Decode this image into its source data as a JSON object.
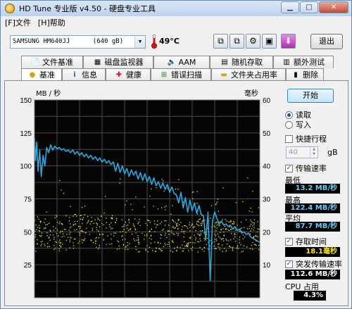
{
  "window": {
    "title": "HD Tune 专业版 v4.50 - 硬盘专业工具"
  },
  "menu": [
    {
      "label": "[F]文件"
    },
    {
      "label": "[H]帮助"
    }
  ],
  "toolbar": {
    "drive_name": "SAMSUNG HM640JJ",
    "drive_size": "(640 gB)",
    "temperature": "49°C",
    "exit_label": "退出"
  },
  "tabs_top": [
    {
      "label": "文件基准",
      "icon": "file-benchmark-icon"
    },
    {
      "label": "磁盘监视器",
      "icon": "disk-monitor-icon"
    },
    {
      "label": "AAM",
      "icon": "speaker-icon"
    },
    {
      "label": "随机存取",
      "icon": "random-access-icon"
    },
    {
      "label": "额外测试",
      "icon": "extra-tests-icon"
    }
  ],
  "tabs_bottom": [
    {
      "label": "基准",
      "icon": "benchmark-icon",
      "active": true
    },
    {
      "label": "信息",
      "icon": "info-icon"
    },
    {
      "label": "健康",
      "icon": "health-icon"
    },
    {
      "label": "错误扫描",
      "icon": "error-scan-icon"
    },
    {
      "label": "文件夹占用率",
      "icon": "folder-usage-icon"
    },
    {
      "label": "删除",
      "icon": "erase-icon"
    }
  ],
  "side": {
    "start_label": "开始",
    "read_label": "读取",
    "write_label": "写入",
    "short_stroke_label": "快捷行程",
    "short_stroke_value": "40",
    "short_stroke_unit": "gB",
    "transfer_rate_label": "传输速率",
    "min_label": "最低",
    "min_value": "13.2 MB/秒",
    "max_label": "最高",
    "max_value": "122.4 MB/秒",
    "avg_label": "平均",
    "avg_value": "87.7 MB/秒",
    "access_time_label": "存取时间",
    "access_time_value": "18.1毫秒",
    "burst_rate_label": "突发传输速率",
    "burst_rate_value": "112.6 MB/秒",
    "cpu_label": "CPU 占用",
    "cpu_value": "4.3%"
  },
  "chart_data": {
    "type": "line",
    "ylabel_left": "MB / 秒",
    "ylabel_right": "毫秒",
    "y_left_ticks": [
      25,
      50,
      75,
      100,
      125,
      150
    ],
    "y_right_ticks": [
      10,
      20,
      30,
      40,
      50,
      60
    ],
    "y_left_range": [
      0,
      150
    ],
    "y_right_range": [
      0,
      60
    ],
    "x_range": [
      0,
      100
    ],
    "grid": true,
    "colors": {
      "transfer_line": "#2aa8e0",
      "access_dots": "#e8e83a",
      "background": "#050505",
      "grid": "#4a4a4a"
    },
    "series": [
      {
        "x": [
          0,
          0.5,
          1,
          1.6,
          2.3,
          3,
          3.8,
          4.6,
          5.4,
          6.3,
          7.2,
          8.1,
          9,
          10,
          11,
          12,
          13,
          14,
          15,
          16,
          17,
          18,
          19,
          20,
          21,
          22,
          23,
          24,
          25,
          26,
          27,
          28,
          29,
          30,
          31,
          32,
          33,
          34,
          35,
          36,
          37,
          38,
          39,
          40,
          41,
          42,
          43,
          44,
          45,
          46,
          47,
          48,
          49,
          50,
          51,
          52,
          53,
          54,
          55,
          56,
          57,
          58,
          59,
          60,
          61,
          62,
          63,
          64,
          65,
          66,
          67,
          68,
          69,
          70,
          71,
          72,
          73,
          74,
          75,
          76,
          77,
          78,
          79,
          80,
          81,
          82,
          83,
          84,
          85,
          86,
          87,
          88,
          89,
          90,
          91,
          92,
          93,
          94,
          95,
          96,
          97,
          98,
          99,
          100
        ],
        "values": [
          122,
          104,
          118,
          96,
          112,
          92,
          108,
          100,
          114,
          110,
          116,
          112,
          115,
          113,
          114,
          112,
          113,
          111,
          112,
          110,
          112,
          109,
          111,
          108,
          110,
          107,
          109,
          106,
          108,
          105,
          107,
          104,
          106,
          103,
          105,
          102,
          104,
          101,
          103,
          96,
          102,
          95,
          100,
          94,
          98,
          92,
          97,
          93,
          96,
          90,
          95,
          89,
          94,
          88,
          92,
          86,
          91,
          85,
          88,
          83,
          87,
          82,
          86,
          80,
          84,
          79,
          78,
          72,
          80,
          68,
          76,
          65,
          74,
          66,
          72,
          64,
          70,
          63,
          62,
          44,
          64,
          13,
          58,
          65,
          60,
          56,
          58,
          55,
          56,
          54,
          55,
          52,
          54,
          51,
          52,
          49,
          50,
          48,
          49,
          46,
          45,
          44,
          43,
          42
        ]
      }
    ]
  }
}
